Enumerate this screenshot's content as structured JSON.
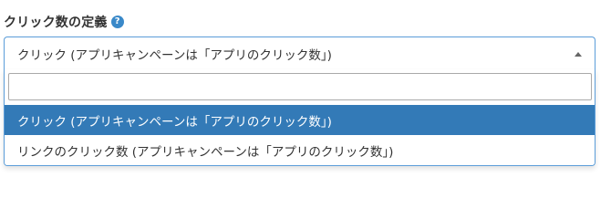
{
  "field": {
    "label": "クリック数の定義",
    "help_icon": "question-circle-icon",
    "help_glyph": "?"
  },
  "select": {
    "selected_value": "クリック (アプリキャンペーンは「アプリのクリック数」)",
    "search_value": "",
    "options": [
      {
        "label": "クリック (アプリキャンペーンは「アプリのクリック数」)",
        "highlighted": true
      },
      {
        "label": "リンクのクリック数 (アプリキャンペーンは「アプリのクリック数」)",
        "highlighted": false
      }
    ]
  },
  "colors": {
    "accent": "#337ab7",
    "focus_border": "#5b9dd9",
    "help_icon": "#3a89c9",
    "text": "#333333"
  }
}
